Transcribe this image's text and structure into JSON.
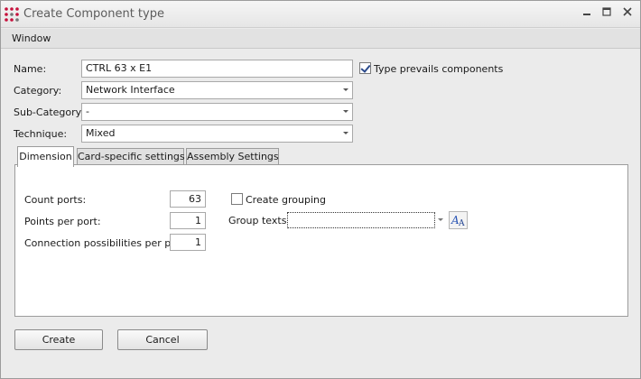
{
  "window": {
    "title": "Create Component type"
  },
  "menu": {
    "items": [
      "Window"
    ]
  },
  "form": {
    "name_label": "Name:",
    "name_value": "CTRL 63 x E1",
    "prevails_label": "Type prevails components",
    "prevails_checked": true,
    "category_label": "Category:",
    "category_value": "Network Interface",
    "subcategory_label": "Sub-Category:",
    "subcategory_value": "-",
    "technique_label": "Technique:",
    "technique_value": "Mixed"
  },
  "tabs": [
    "Dimension",
    "Card-specific settings",
    "Assembly Settings"
  ],
  "active_tab": "Dimension",
  "dimension": {
    "count_ports_label": "Count ports:",
    "count_ports_value": "63",
    "points_per_port_label": "Points per port:",
    "points_per_port_value": "1",
    "connection_label": "Connection possibilities per port:",
    "connection_value": "1",
    "create_grouping_label": "Create grouping",
    "create_grouping_checked": false,
    "group_texts_label": "Group texts:",
    "group_texts_value": ""
  },
  "buttons": {
    "create": "Create",
    "cancel": "Cancel"
  },
  "icons": {
    "app": "app-logo-icon",
    "minimize": "minimize-icon",
    "maximize": "maximize-icon",
    "close": "close-icon",
    "dropdown": "chevron-down-icon",
    "font": "font-icon"
  },
  "colors": {
    "accent": "#c6113c",
    "panel": "#ffffff",
    "window": "#ebebeb"
  }
}
